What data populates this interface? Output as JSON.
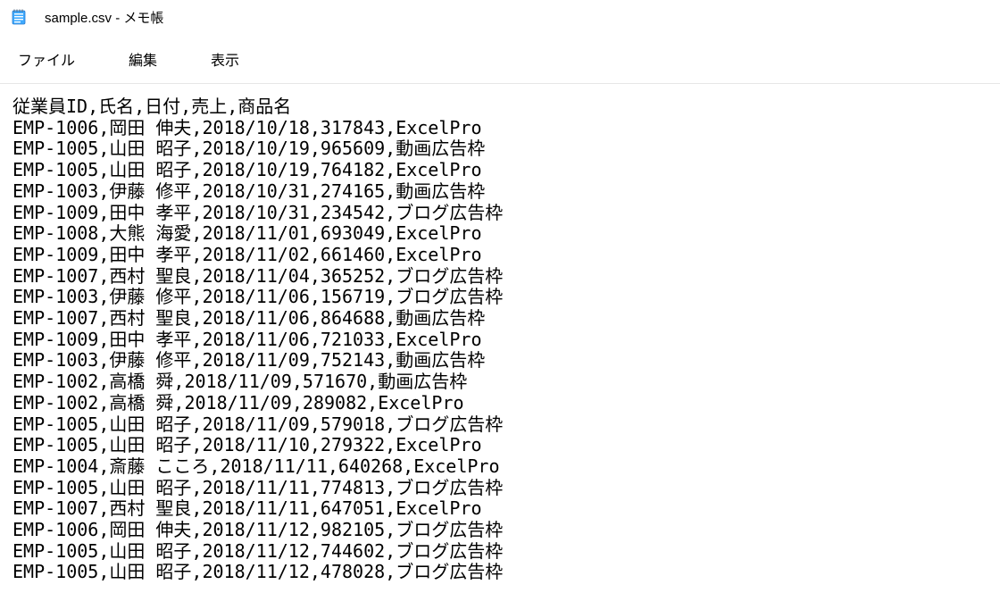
{
  "window": {
    "title": "sample.csv - メモ帳"
  },
  "menu": {
    "file": "ファイル",
    "edit": "編集",
    "view": "表示"
  },
  "content_lines": [
    "従業員ID,氏名,日付,売上,商品名",
    "EMP-1006,岡田 伸夫,2018/10/18,317843,ExcelPro",
    "EMP-1005,山田 昭子,2018/10/19,965609,動画広告枠",
    "EMP-1005,山田 昭子,2018/10/19,764182,ExcelPro",
    "EMP-1003,伊藤 修平,2018/10/31,274165,動画広告枠",
    "EMP-1009,田中 孝平,2018/10/31,234542,ブログ広告枠",
    "EMP-1008,大熊 海愛,2018/11/01,693049,ExcelPro",
    "EMP-1009,田中 孝平,2018/11/02,661460,ExcelPro",
    "EMP-1007,西村 聖良,2018/11/04,365252,ブログ広告枠",
    "EMP-1003,伊藤 修平,2018/11/06,156719,ブログ広告枠",
    "EMP-1007,西村 聖良,2018/11/06,864688,動画広告枠",
    "EMP-1009,田中 孝平,2018/11/06,721033,ExcelPro",
    "EMP-1003,伊藤 修平,2018/11/09,752143,動画広告枠",
    "EMP-1002,高橋 舜,2018/11/09,571670,動画広告枠",
    "EMP-1002,高橋 舜,2018/11/09,289082,ExcelPro",
    "EMP-1005,山田 昭子,2018/11/09,579018,ブログ広告枠",
    "EMP-1005,山田 昭子,2018/11/10,279322,ExcelPro",
    "EMP-1004,斎藤 こころ,2018/11/11,640268,ExcelPro",
    "EMP-1005,山田 昭子,2018/11/11,774813,ブログ広告枠",
    "EMP-1007,西村 聖良,2018/11/11,647051,ExcelPro",
    "EMP-1006,岡田 伸夫,2018/11/12,982105,ブログ広告枠",
    "EMP-1005,山田 昭子,2018/11/12,744602,ブログ広告枠",
    "EMP-1005,山田 昭子,2018/11/12,478028,ブログ広告枠"
  ]
}
